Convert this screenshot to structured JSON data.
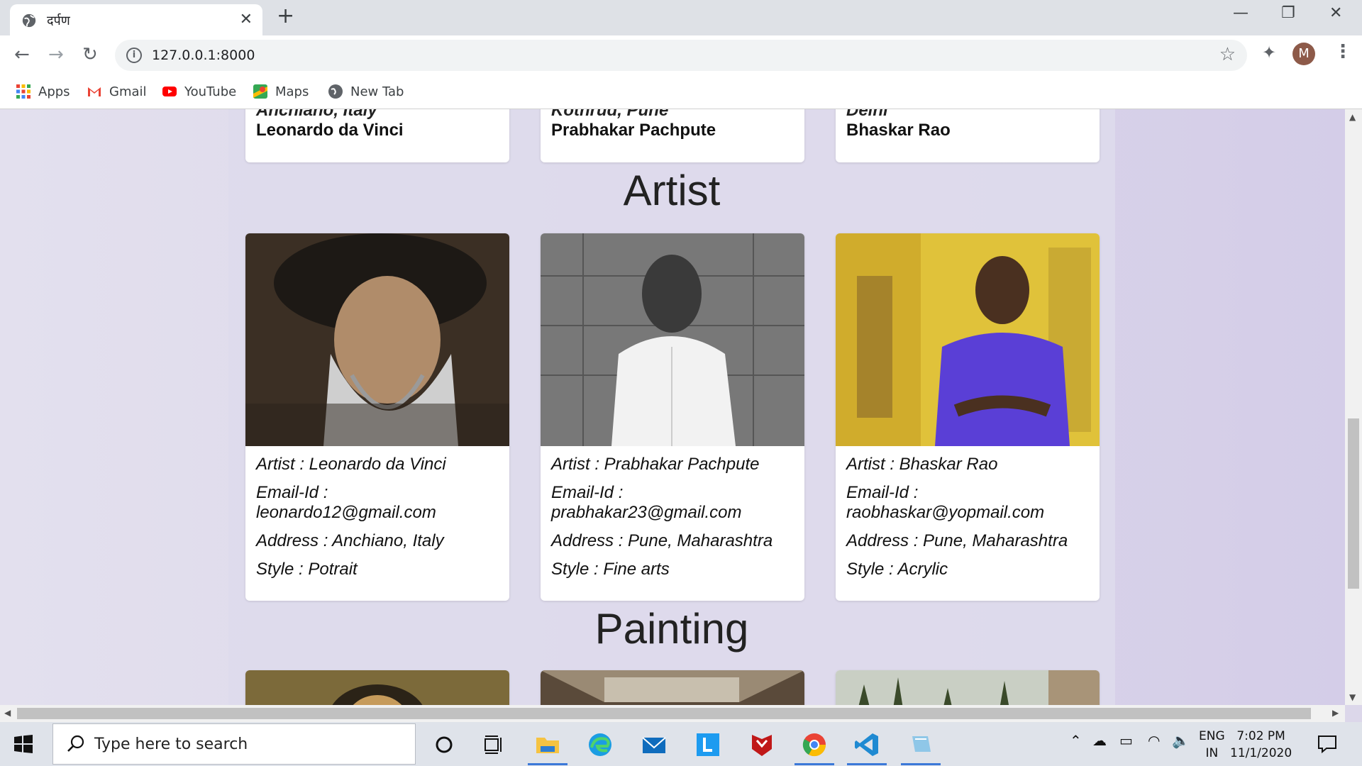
{
  "browser": {
    "tab_title": "दर्पण",
    "tab_close": "✕",
    "new_tab": "+",
    "url": "127.0.0.1:8000",
    "profile_initial": "M",
    "bookmarks": [
      "Apps",
      "Gmail",
      "YouTube",
      "Maps",
      "New Tab"
    ]
  },
  "page": {
    "top_cards": [
      {
        "partial_address": "Anchiano, Italy",
        "name": "Leonardo da Vinci"
      },
      {
        "partial_address": "Kothrud, Pune",
        "name": "Prabhakar Pachpute"
      },
      {
        "partial_address": "Delhi",
        "name": "Bhaskar Rao"
      }
    ],
    "artist_heading": "Artist",
    "artists": [
      {
        "artist": "Artist : Leonardo da Vinci",
        "email_label": "Email-Id :",
        "email": "leonardo12@gmail.com",
        "address": "Address : Anchiano, Italy",
        "style": "Style : Potrait"
      },
      {
        "artist": "Artist : Prabhakar Pachpute",
        "email_label": "Email-Id :",
        "email": "prabhakar23@gmail.com",
        "address": "Address : Pune, Maharashtra",
        "style": "Style : Fine arts"
      },
      {
        "artist": "Artist : Bhaskar Rao",
        "email_label": "Email-Id :",
        "email": "raobhaskar@yopmail.com",
        "address": "Address : Pune, Maharashtra",
        "style": "Style : Acrylic"
      }
    ],
    "painting_heading": "Painting"
  },
  "taskbar": {
    "search_placeholder": "Type here to search",
    "lang_top": "ENG",
    "lang_bottom": "IN",
    "time": "7:02 PM",
    "date": "11/1/2020"
  },
  "colors": {
    "page_bg": "#dcd7ea",
    "card_bg": "#ffffff",
    "accent_blue": "#3b78d8"
  }
}
